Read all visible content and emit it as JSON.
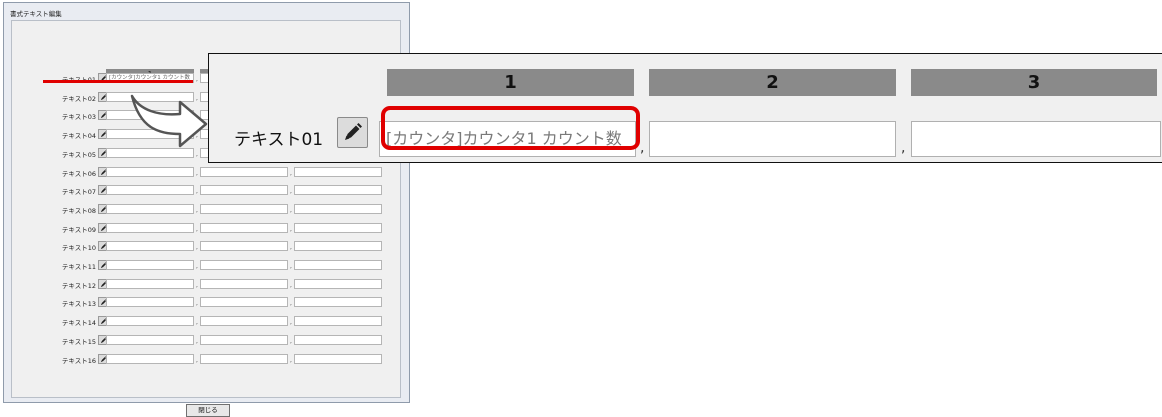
{
  "dialog": {
    "title": "書式テキスト編集",
    "columns": [
      "1",
      "2",
      "3"
    ],
    "rows": [
      {
        "label": "テキスト01",
        "cells": [
          "[カウンタ]カウンタ1 カウント数",
          "",
          ""
        ]
      },
      {
        "label": "テキスト02",
        "cells": [
          "",
          "",
          ""
        ]
      },
      {
        "label": "テキスト03",
        "cells": [
          "",
          "",
          ""
        ]
      },
      {
        "label": "テキスト04",
        "cells": [
          "",
          "",
          ""
        ]
      },
      {
        "label": "テキスト05",
        "cells": [
          "",
          "",
          ""
        ]
      },
      {
        "label": "テキスト06",
        "cells": [
          "",
          "",
          ""
        ]
      },
      {
        "label": "テキスト07",
        "cells": [
          "",
          "",
          ""
        ]
      },
      {
        "label": "テキスト08",
        "cells": [
          "",
          "",
          ""
        ]
      },
      {
        "label": "テキスト09",
        "cells": [
          "",
          "",
          ""
        ]
      },
      {
        "label": "テキスト10",
        "cells": [
          "",
          "",
          ""
        ]
      },
      {
        "label": "テキスト11",
        "cells": [
          "",
          "",
          ""
        ]
      },
      {
        "label": "テキスト12",
        "cells": [
          "",
          "",
          ""
        ]
      },
      {
        "label": "テキスト13",
        "cells": [
          "",
          "",
          ""
        ]
      },
      {
        "label": "テキスト14",
        "cells": [
          "",
          "",
          ""
        ]
      },
      {
        "label": "テキスト15",
        "cells": [
          "",
          "",
          ""
        ]
      },
      {
        "label": "テキスト16",
        "cells": [
          "",
          "",
          ""
        ]
      }
    ],
    "separator": ",",
    "close_label": "閉じる"
  },
  "zoom": {
    "columns": [
      "1",
      "2",
      "3"
    ],
    "row_label": "テキスト01",
    "cells": [
      "[カウンタ]カウンタ1 カウント数",
      "",
      ""
    ],
    "separator": ","
  },
  "icons": {
    "edit": "pencil-icon",
    "callout_arrow": "arrow-right-icon"
  },
  "colors": {
    "highlight": "#e00000",
    "header_bar": "#8a8a8a"
  }
}
